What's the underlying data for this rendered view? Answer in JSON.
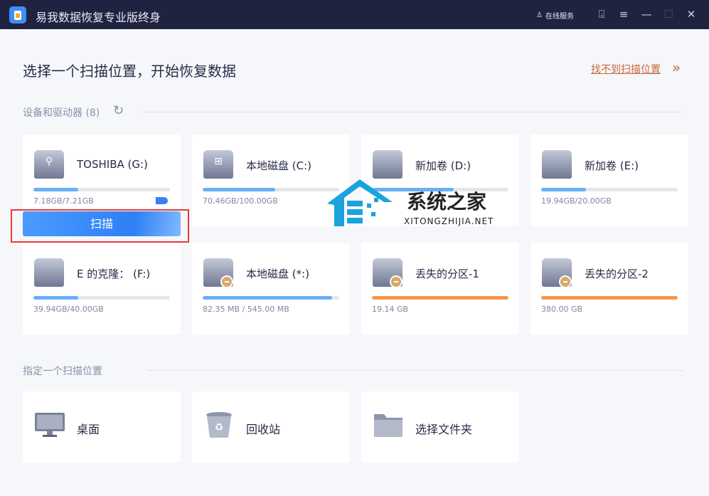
{
  "app": {
    "title": "易我数据恢复专业版终身",
    "online_service": "在线服务"
  },
  "window_controls": [
    "upgrade",
    "menu",
    "minimize",
    "maximize",
    "close"
  ],
  "heading": "选择一个扫描位置，开始恢复数据",
  "help_link": "找不到扫描位置",
  "devices_section": {
    "label": "设备和驱动器",
    "count": "(8)"
  },
  "drives": [
    {
      "name": "TOSHIBA (G:)",
      "size": "7.18GB/7.21GB",
      "fill": 0.33,
      "icon": "usb-drive-icon",
      "color": "#69aef8"
    },
    {
      "name": "本地磁盘 (C:)",
      "size": "70.46GB/100.00GB",
      "fill": 0.53,
      "icon": "windows-drive-icon",
      "color": "#69aef8"
    },
    {
      "name": "新加卷 (D:)",
      "size": "",
      "fill": 0.6,
      "icon": "drive-icon",
      "color": "#69aef8"
    },
    {
      "name": "新加卷 (E:)",
      "size": "19.94GB/20.00GB",
      "fill": 0.33,
      "icon": "drive-icon",
      "color": "#69aef8"
    },
    {
      "name": "E 的克隆：  (F:)",
      "size": "39.94GB/40.00GB",
      "fill": 0.33,
      "icon": "drive-icon",
      "color": "#69aef8"
    },
    {
      "name": "本地磁盘 (*:)",
      "size": "82.35 MB / 545.00 MB",
      "fill": 0.95,
      "icon": "hidden-drive-icon",
      "color": "#69aef8"
    },
    {
      "name": "丢失的分区-1",
      "size": "19.14 GB",
      "fill": 1,
      "icon": "lost-partition-icon",
      "color": "#f8954c"
    },
    {
      "name": "丢失的分区-2",
      "size": "380.00 GB",
      "fill": 1,
      "icon": "lost-partition-icon",
      "color": "#f8954c"
    }
  ],
  "scan_button": "扫描",
  "location_section": {
    "label": "指定一个扫描位置"
  },
  "locations": [
    {
      "name": "桌面"
    },
    {
      "name": "回收站"
    },
    {
      "name": "选择文件夹"
    }
  ],
  "watermark": {
    "text": "系统之家",
    "sub": "XITONGZHIJIA.NET"
  }
}
